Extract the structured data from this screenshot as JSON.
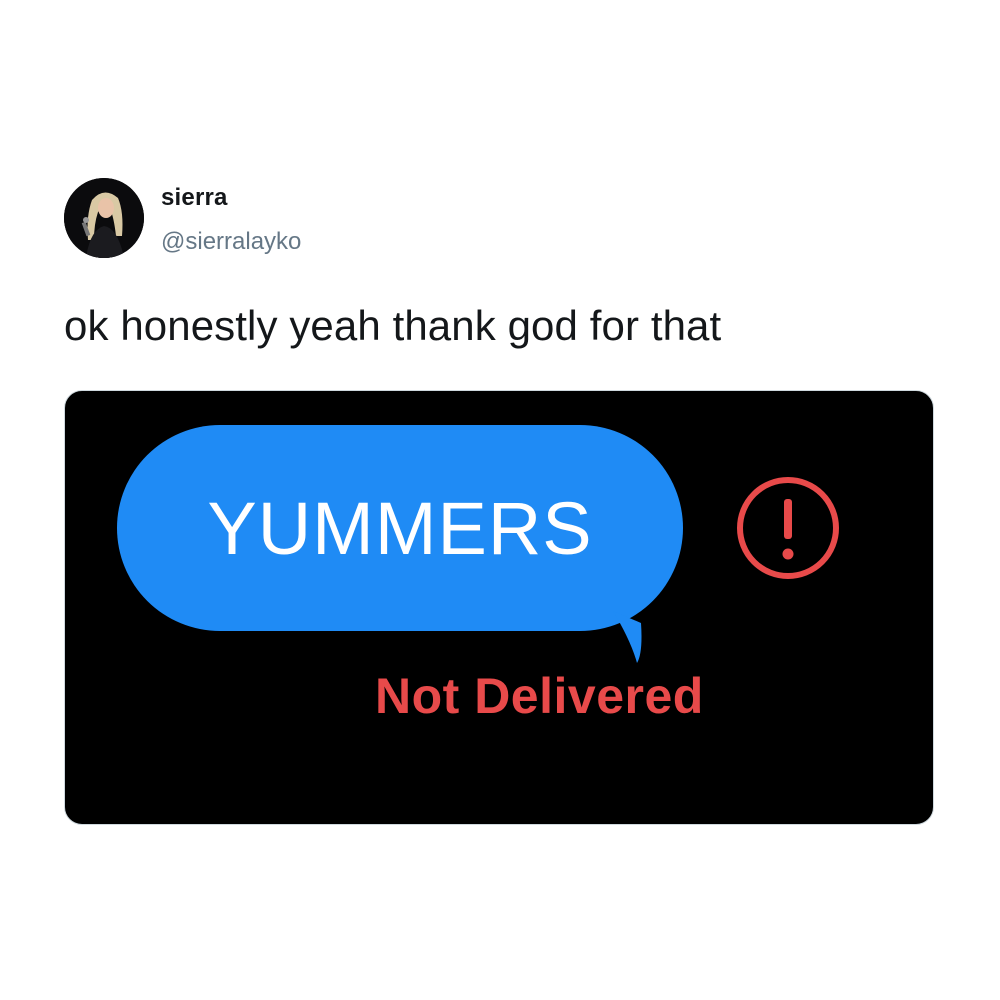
{
  "tweet": {
    "display_name": "sierra",
    "handle": "@sierralayko",
    "text": "ok honestly yeah thank god for that"
  },
  "media": {
    "message_text": "YUMMERS",
    "status_text": "Not Delivered",
    "icons": {
      "avatar": "profile-photo",
      "status": "exclamation-circle-icon"
    },
    "colors": {
      "bubble": "#1f8bf5",
      "status": "#e84a4a",
      "background": "#000000"
    }
  }
}
